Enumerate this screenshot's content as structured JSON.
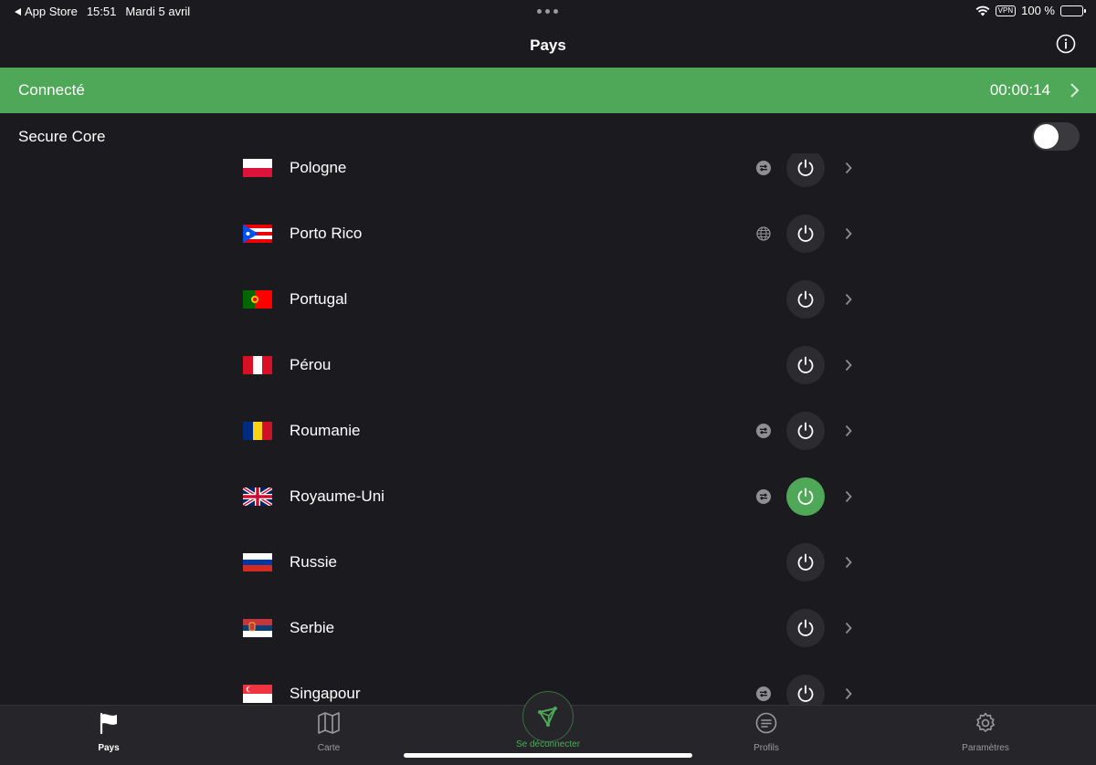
{
  "status_bar": {
    "back_app": "App Store",
    "time": "15:51",
    "date": "Mardi 5 avril",
    "vpn_badge": "VPN",
    "battery": "100 %"
  },
  "nav": {
    "title": "Pays"
  },
  "banner": {
    "label": "Connecté",
    "timer": "00:00:14",
    "color": "#4ea858"
  },
  "secure_core": {
    "label": "Secure Core",
    "enabled": false
  },
  "countries": [
    {
      "name": "Pologne",
      "feature": "p2p-icon",
      "connected": false
    },
    {
      "name": "Porto Rico",
      "feature": "globe-icon",
      "connected": false
    },
    {
      "name": "Portugal",
      "feature": null,
      "connected": false
    },
    {
      "name": "Pérou",
      "feature": null,
      "connected": false
    },
    {
      "name": "Roumanie",
      "feature": "p2p-icon",
      "connected": false
    },
    {
      "name": "Royaume-Uni",
      "feature": "p2p-icon",
      "connected": true
    },
    {
      "name": "Russie",
      "feature": null,
      "connected": false
    },
    {
      "name": "Serbie",
      "feature": null,
      "connected": false
    },
    {
      "name": "Singapour",
      "feature": "p2p-icon",
      "connected": false
    }
  ],
  "tabs": {
    "countries": "Pays",
    "map": "Carte",
    "connect": "Se déconnecter",
    "profiles": "Profils",
    "settings": "Paramètres"
  }
}
